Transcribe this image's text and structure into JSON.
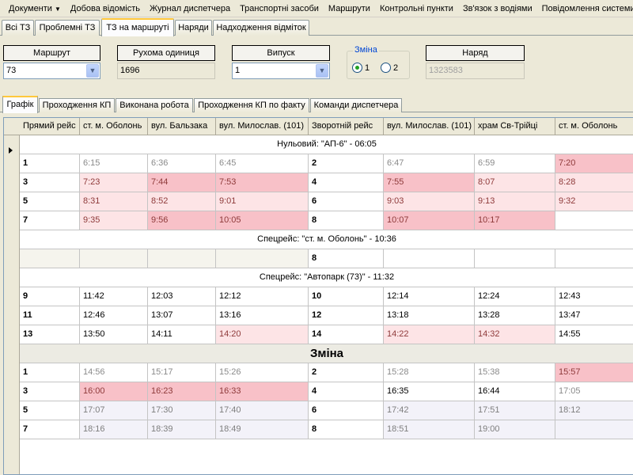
{
  "menu": {
    "items": [
      "Документи",
      "Добова відомість",
      "Журнал диспетчера",
      "Транспортні засоби",
      "Маршрути",
      "Контрольні пункти",
      "Зв'язок з водіями",
      "Повідомлення системи"
    ]
  },
  "top_tabs": [
    "Всі ТЗ",
    "Проблемні ТЗ",
    "ТЗ на маршруті",
    "Наряди",
    "Надходження відміток"
  ],
  "active_top_tab": "ТЗ на маршруті",
  "filters": {
    "route_label": "Маршрут",
    "route_value": "73",
    "vehicle_label": "Рухома одиниця",
    "vehicle_value": "1696",
    "release_label": "Випуск",
    "release_value": "1",
    "shift_legend": "Зміна",
    "shift_options": [
      "1",
      "2"
    ],
    "shift_selected": "1",
    "order_label": "Наряд",
    "order_value": "1323583"
  },
  "sub_tabs": [
    "Графік",
    "Проходження КП",
    "Виконана робота",
    "Проходження КП по факту",
    "Команди диспетчера"
  ],
  "active_sub_tab": "Графік",
  "grid": {
    "columns": [
      "Прямий рейс",
      "ст. м. Оболонь",
      "вул. Бальзака",
      "вул. Милослав. (101)",
      "Зворотній рейс",
      "вул. Милослав. (101)",
      "храм Св-Трійці",
      "ст. м. Оболонь"
    ],
    "rows": [
      {
        "kind": "banner",
        "text": "Нульовий:   \"АП-6\" - 06:05"
      },
      {
        "kind": "data",
        "cells": [
          [
            "1",
            "b"
          ],
          [
            "6:15",
            "g"
          ],
          [
            "6:36",
            "g"
          ],
          [
            "6:45",
            "g"
          ],
          [
            "2",
            "b"
          ],
          [
            "6:47",
            "g"
          ],
          [
            "6:59",
            "g"
          ],
          [
            "7:20",
            "d"
          ]
        ]
      },
      {
        "kind": "data",
        "cells": [
          [
            "3",
            "b"
          ],
          [
            "7:23",
            "l"
          ],
          [
            "7:44",
            "d"
          ],
          [
            "7:53",
            "d"
          ],
          [
            "4",
            "b"
          ],
          [
            "7:55",
            "d"
          ],
          [
            "8:07",
            "l"
          ],
          [
            "8:28",
            "l"
          ]
        ]
      },
      {
        "kind": "data",
        "cells": [
          [
            "5",
            "b"
          ],
          [
            "8:31",
            "l"
          ],
          [
            "8:52",
            "l"
          ],
          [
            "9:01",
            "l"
          ],
          [
            "6",
            "b"
          ],
          [
            "9:03",
            "l"
          ],
          [
            "9:13",
            "l"
          ],
          [
            "9:32",
            "l"
          ]
        ]
      },
      {
        "kind": "data",
        "cells": [
          [
            "7",
            "b"
          ],
          [
            "9:35",
            "l"
          ],
          [
            "9:56",
            "d"
          ],
          [
            "10:05",
            "d"
          ],
          [
            "8",
            "b"
          ],
          [
            "10:07",
            "d"
          ],
          [
            "10:17",
            "d"
          ],
          [
            "",
            ""
          ]
        ]
      },
      {
        "kind": "banner",
        "text": "Спецрейс:   \"ст. м. Оболонь\" - 10:36"
      },
      {
        "kind": "data",
        "cells": [
          [
            "",
            "e"
          ],
          [
            "",
            "e"
          ],
          [
            "",
            "e"
          ],
          [
            "",
            "e"
          ],
          [
            "8",
            "b"
          ],
          [
            "",
            ""
          ],
          [
            "",
            ""
          ],
          [
            "",
            ""
          ]
        ]
      },
      {
        "kind": "banner",
        "text": "Спецрейс:   \"Автопарк (73)\" - 11:32"
      },
      {
        "kind": "data",
        "cells": [
          [
            "9",
            "b"
          ],
          [
            "11:42",
            "k"
          ],
          [
            "12:03",
            "k"
          ],
          [
            "12:12",
            "k"
          ],
          [
            "10",
            "b"
          ],
          [
            "12:14",
            "k"
          ],
          [
            "12:24",
            "k"
          ],
          [
            "12:43",
            "k"
          ]
        ]
      },
      {
        "kind": "data",
        "cells": [
          [
            "11",
            "b"
          ],
          [
            "12:46",
            "k"
          ],
          [
            "13:07",
            "k"
          ],
          [
            "13:16",
            "k"
          ],
          [
            "12",
            "b"
          ],
          [
            "13:18",
            "k"
          ],
          [
            "13:28",
            "k"
          ],
          [
            "13:47",
            "k"
          ]
        ]
      },
      {
        "kind": "data",
        "cells": [
          [
            "13",
            "b"
          ],
          [
            "13:50",
            "k"
          ],
          [
            "14:11",
            "k"
          ],
          [
            "14:20",
            "l"
          ],
          [
            "14",
            "b"
          ],
          [
            "14:22",
            "l"
          ],
          [
            "14:32",
            "l"
          ],
          [
            "14:55",
            "k"
          ]
        ]
      },
      {
        "kind": "big",
        "text": "Зміна"
      },
      {
        "kind": "data",
        "cells": [
          [
            "1",
            "b"
          ],
          [
            "14:56",
            "g"
          ],
          [
            "15:17",
            "g"
          ],
          [
            "15:26",
            "g"
          ],
          [
            "2",
            "b"
          ],
          [
            "15:28",
            "g"
          ],
          [
            "15:38",
            "g"
          ],
          [
            "15:57",
            "d"
          ]
        ]
      },
      {
        "kind": "data",
        "cells": [
          [
            "3",
            "b"
          ],
          [
            "16:00",
            "d"
          ],
          [
            "16:23",
            "d"
          ],
          [
            "16:33",
            "d"
          ],
          [
            "4",
            "b"
          ],
          [
            "16:35",
            "k"
          ],
          [
            "16:44",
            "k"
          ],
          [
            "17:05",
            "g"
          ]
        ]
      },
      {
        "kind": "data",
        "cells": [
          [
            "5",
            "b"
          ],
          [
            "17:07",
            "p"
          ],
          [
            "17:30",
            "p"
          ],
          [
            "17:40",
            "p"
          ],
          [
            "6",
            "b"
          ],
          [
            "17:42",
            "p"
          ],
          [
            "17:51",
            "p"
          ],
          [
            "18:12",
            "p"
          ]
        ]
      },
      {
        "kind": "data",
        "cells": [
          [
            "7",
            "b"
          ],
          [
            "18:16",
            "p"
          ],
          [
            "18:39",
            "p"
          ],
          [
            "18:49",
            "p"
          ],
          [
            "8",
            "b"
          ],
          [
            "18:51",
            "p"
          ],
          [
            "19:00",
            "p"
          ],
          [
            "",
            "p"
          ]
        ]
      }
    ]
  }
}
